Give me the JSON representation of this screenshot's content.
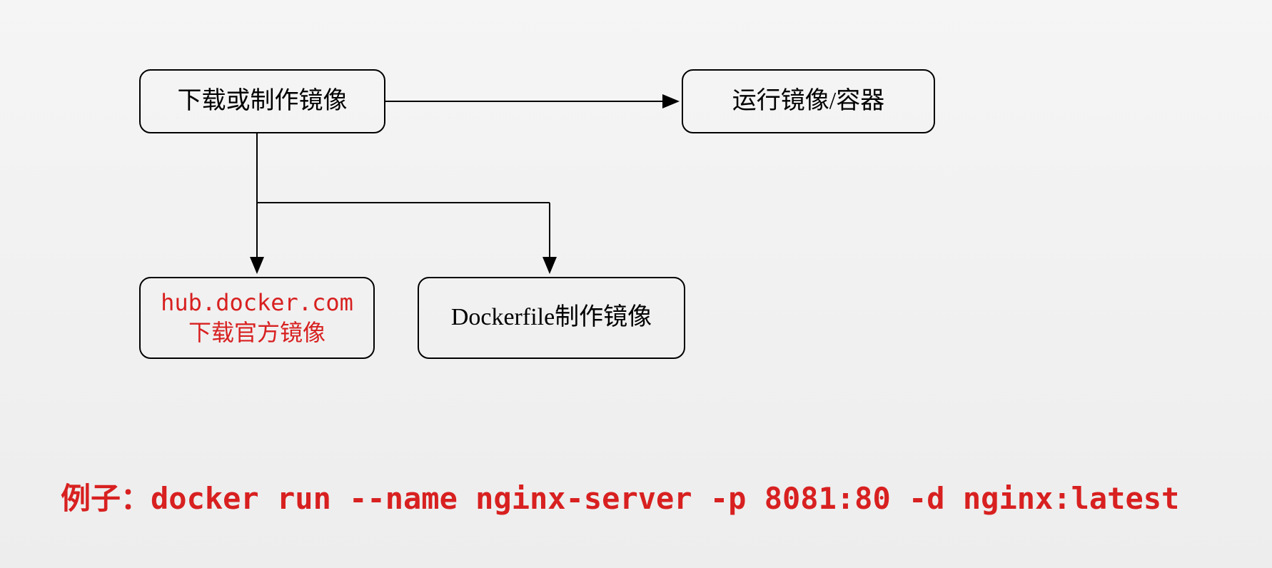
{
  "diagram": {
    "nodes": {
      "download_or_make": "下载或制作镜像",
      "run_image": "运行镜像/容器",
      "hub_docker": "hub.docker.com　 下载官方镜像",
      "dockerfile": "Dockerfile制作镜像"
    },
    "edges": [
      {
        "from": "download_or_make",
        "to": "run_image",
        "direction": "right"
      },
      {
        "from": "download_or_make",
        "to": "hub_docker",
        "direction": "down"
      },
      {
        "from": "download_or_make",
        "to": "dockerfile",
        "direction": "down-right"
      }
    ]
  },
  "example": "例子：docker run --name nginx-server -p 8081:80 -d nginx:latest"
}
